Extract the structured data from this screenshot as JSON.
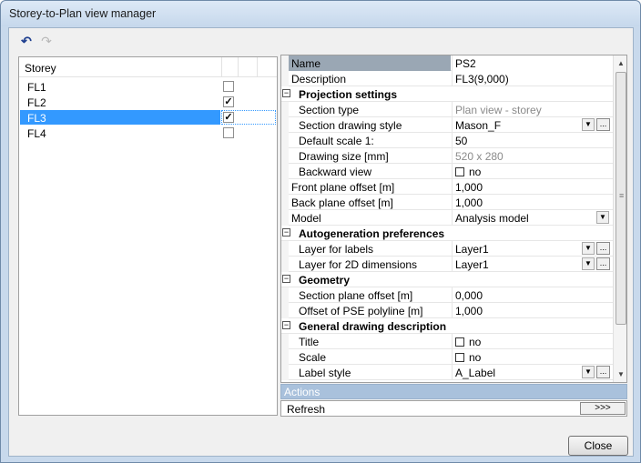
{
  "window": {
    "title": "Storey-to-Plan view manager"
  },
  "toolbar": {
    "undo_icon": "undo-icon",
    "redo_icon": "redo-icon"
  },
  "storey_list": {
    "header": "Storey",
    "items": [
      {
        "name": "FL1",
        "checked": false,
        "selected": false
      },
      {
        "name": "FL2",
        "checked": true,
        "selected": false
      },
      {
        "name": "FL3",
        "checked": true,
        "selected": true
      },
      {
        "name": "FL4",
        "checked": false,
        "selected": false
      }
    ]
  },
  "properties": {
    "name": {
      "label": "Name",
      "value": "PS2"
    },
    "description": {
      "label": "Description",
      "value": "FL3(9,000)"
    },
    "projection_settings": {
      "title": "Projection settings",
      "section_type": {
        "label": "Section type",
        "value": "Plan view - storey"
      },
      "section_drawing_style": {
        "label": "Section drawing style",
        "value": "Mason_F"
      },
      "default_scale": {
        "label": "Default scale 1:",
        "value": "50"
      },
      "drawing_size": {
        "label": "Drawing size [mm]",
        "value": "520 x 280"
      },
      "backward_view": {
        "label": "Backward view",
        "value": "no"
      }
    },
    "front_plane_offset": {
      "label": "Front plane offset [m]",
      "value": "1,000"
    },
    "back_plane_offset": {
      "label": "Back plane offset [m]",
      "value": "1,000"
    },
    "model": {
      "label": "Model",
      "value": "Analysis model"
    },
    "autogeneration": {
      "title": "Autogeneration preferences",
      "layer_labels": {
        "label": "Layer for labels",
        "value": "Layer1"
      },
      "layer_2d": {
        "label": "Layer for 2D dimensions",
        "value": "Layer1"
      }
    },
    "geometry": {
      "title": "Geometry",
      "section_plane_offset": {
        "label": "Section plane offset [m]",
        "value": "0,000"
      },
      "pse_offset": {
        "label": "Offset of PSE polyline [m]",
        "value": "1,000"
      }
    },
    "general": {
      "title": "General drawing description",
      "title_row": {
        "label": "Title",
        "value": "no"
      },
      "scale": {
        "label": "Scale",
        "value": "no"
      },
      "label_style": {
        "label": "Label style",
        "value": "A_Label"
      }
    }
  },
  "actions": {
    "title": "Actions",
    "refresh": "Refresh",
    "refresh_button": ">>>"
  },
  "buttons": {
    "close": "Close"
  },
  "colors": {
    "selection": "#3399ff",
    "actions_bar": "#a9c1dc",
    "header_cell": "#9aa7b4"
  }
}
